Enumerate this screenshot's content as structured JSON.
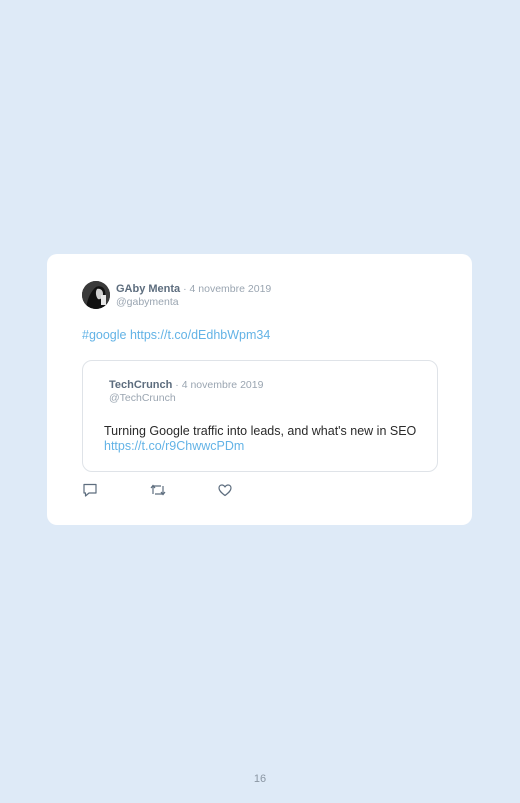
{
  "tweet": {
    "author_name": "GAby Menta",
    "separator": " · ",
    "date": "4 novembre 2019",
    "handle": "@gabymenta",
    "text": "#google https://t.co/dEdhbWpm34"
  },
  "quoted_tweet": {
    "author_name": "TechCrunch",
    "separator": " · ",
    "date": "4 novembre 2019",
    "handle": "@TechCrunch",
    "text": "Turning Google traffic into leads, and what's new in SEO ",
    "link": "https://t.co/r9ChwwcPDm"
  },
  "actions": [
    {
      "icon": "reply-icon"
    },
    {
      "icon": "retweet-icon"
    },
    {
      "icon": "like-icon"
    }
  ],
  "footer": {
    "page_number": "16"
  },
  "colors": {
    "background": "#deeaf7",
    "card": "#ffffff",
    "link": "#63b3e6",
    "muted": "#9aa5b1",
    "name": "#5d6d7e"
  }
}
